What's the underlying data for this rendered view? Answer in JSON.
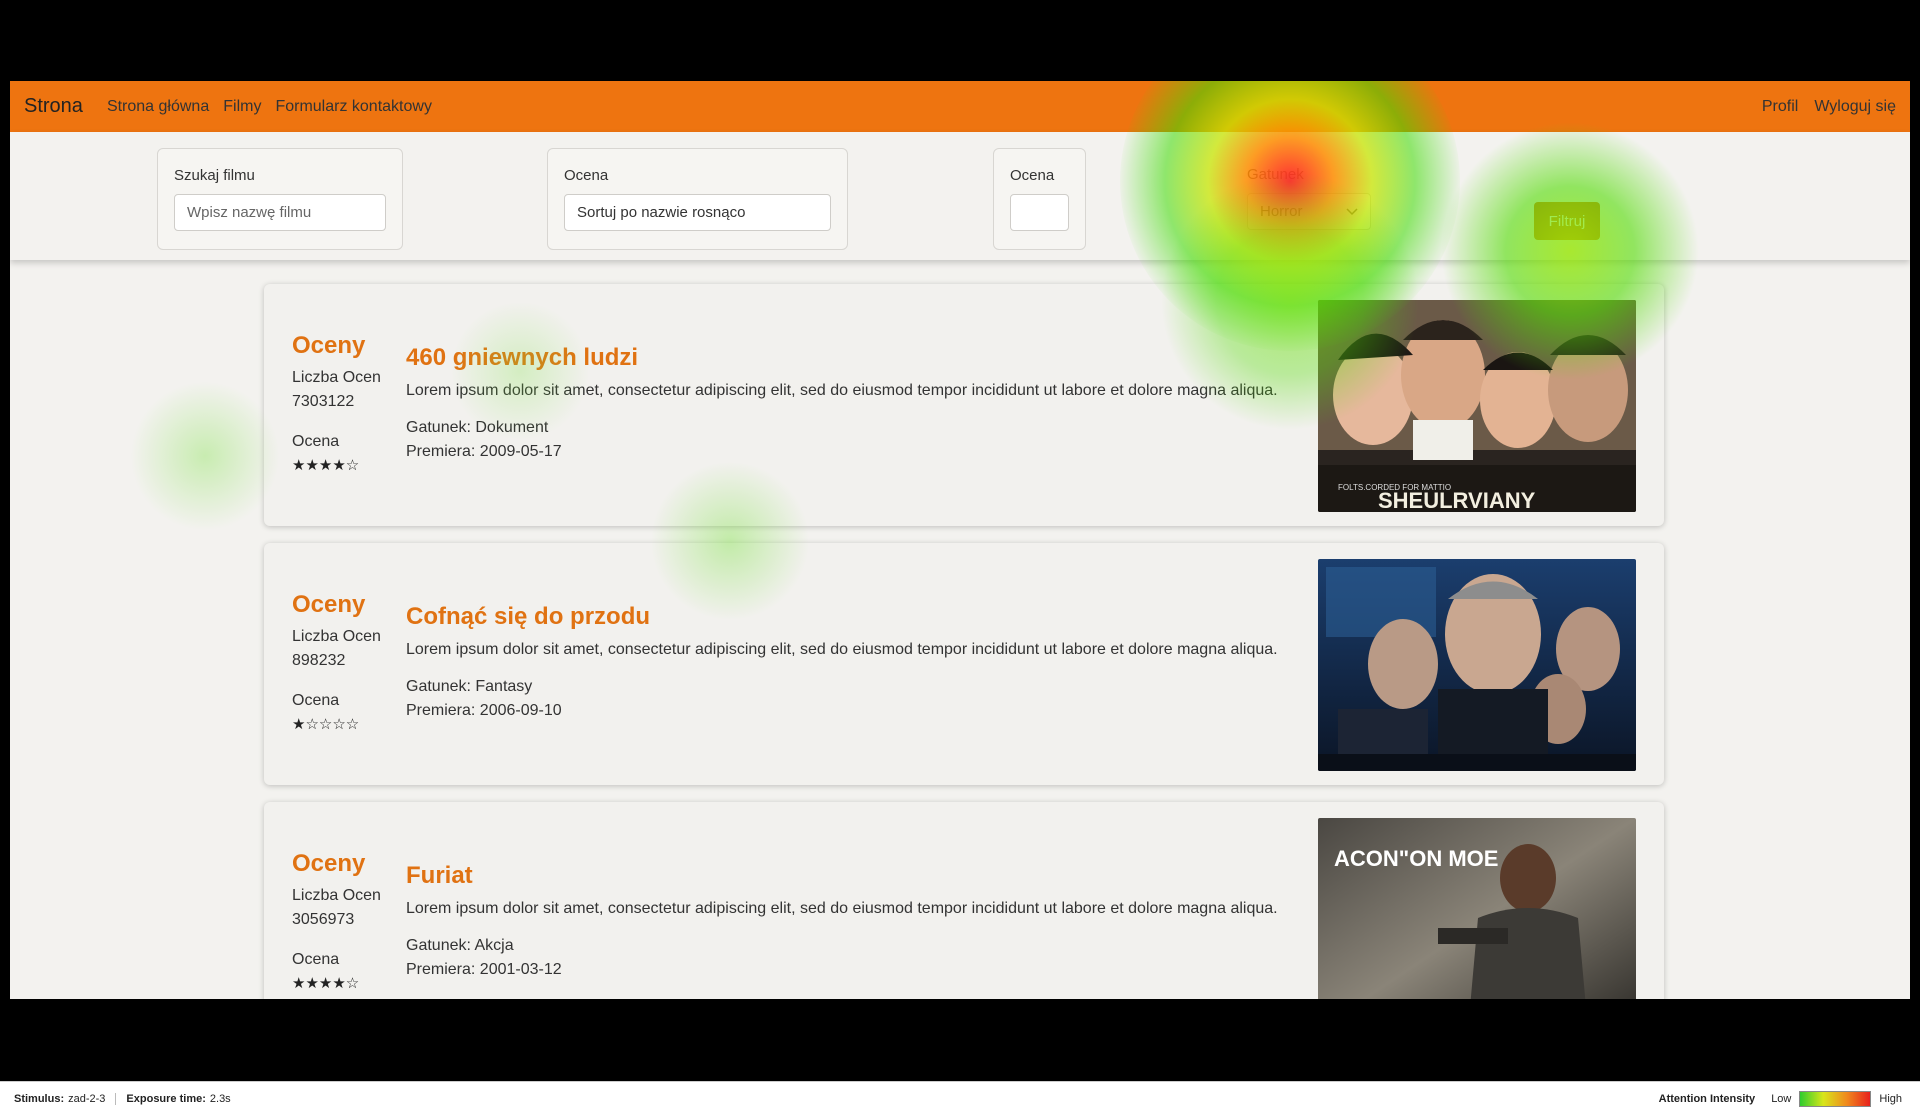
{
  "navbar": {
    "brand": "Strona",
    "links": [
      "Strona główna",
      "Filmy",
      "Formularz kontaktowy"
    ],
    "right_links": [
      "Profil",
      "Wyloguj się"
    ]
  },
  "filters": {
    "search": {
      "label": "Szukaj filmu",
      "placeholder": "Wpisz nazwę filmu"
    },
    "sort": {
      "label": "Ocena",
      "value": "Sortuj po nazwie rosnąco"
    },
    "rating": {
      "label": "Ocena",
      "value": ""
    },
    "genre": {
      "label": "Gatunek",
      "value": "Horror"
    },
    "button": "Filtruj"
  },
  "movies": [
    {
      "ratings_title": "Oceny",
      "count_label": "Liczba Ocen",
      "count": "7303122",
      "rating_label": "Ocena",
      "stars": "★★★★☆",
      "title": "460 gniewnych ludzi",
      "description": "Lorem ipsum dolor sit amet, consectetur adipiscing elit, sed do eiusmod tempor incididunt ut labore et dolore magna aliqua.",
      "genre": "Gatunek: Dokument",
      "premiere": "Premiera: 2009-05-17",
      "poster_text": "SHEULRVIANY"
    },
    {
      "ratings_title": "Oceny",
      "count_label": "Liczba Ocen",
      "count": "898232",
      "rating_label": "Ocena",
      "stars": "★☆☆☆☆",
      "title": "Cofnąć się do przodu",
      "description": "Lorem ipsum dolor sit amet, consectetur adipiscing elit, sed do eiusmod tempor incididunt ut labore et dolore magna aliqua.",
      "genre": "Gatunek: Fantasy",
      "premiere": "Premiera: 2006-09-10",
      "poster_text": ""
    },
    {
      "ratings_title": "Oceny",
      "count_label": "Liczba Ocen",
      "count": "3056973",
      "rating_label": "Ocena",
      "stars": "★★★★☆",
      "title": "Furiat",
      "description": "Lorem ipsum dolor sit amet, consectetur adipiscing elit, sed do eiusmod tempor incididunt ut labore et dolore magna aliqua.",
      "genre": "Gatunek: Akcja",
      "premiere": "Premiera: 2001-03-12",
      "poster_text": "ACON\"ON MOE"
    }
  ],
  "legend": {
    "stimulus_label": "Stimulus:",
    "stimulus_value": "zad-2-3",
    "exposure_label": "Exposure time:",
    "exposure_value": "2.3s",
    "intensity_label": "Attention Intensity",
    "low": "Low",
    "high": "High",
    "gradient_colors": [
      "#2ecc2e",
      "#d8e61b",
      "#f08a1c",
      "#e8201c"
    ]
  }
}
